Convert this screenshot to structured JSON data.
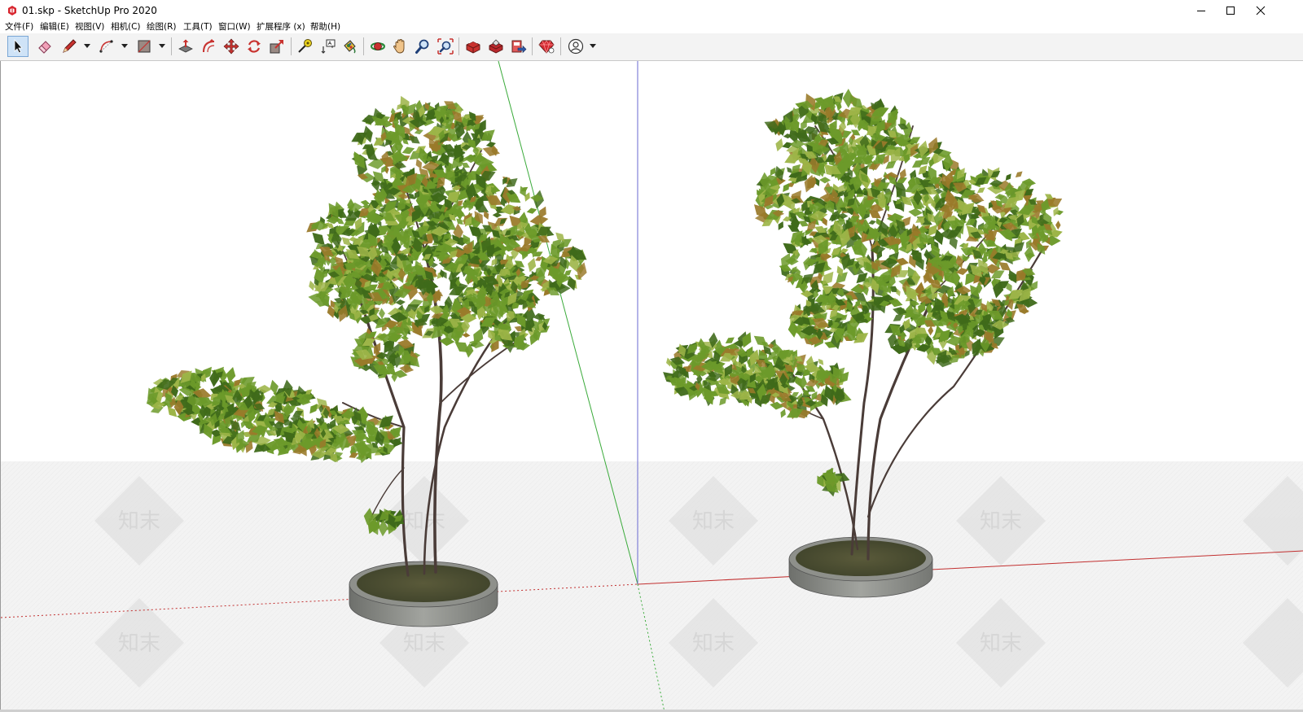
{
  "window": {
    "title": "01.skp - SketchUp Pro 2020"
  },
  "menu": [
    "文件(F)",
    "编辑(E)",
    "视图(V)",
    "相机(C)",
    "绘图(R)",
    "工具(T)",
    "窗口(W)",
    "扩展程序 (x)",
    "帮助(H)"
  ],
  "toolbar": {
    "tools": [
      {
        "icon": "select-arrow-icon",
        "active": true
      },
      {
        "icon": "eraser-icon"
      },
      {
        "icon": "pencil-line-icon"
      },
      {
        "icon": "arc-icon"
      },
      {
        "icon": "rectangle-shape-icon"
      },
      {
        "icon": "push-pull-icon"
      },
      {
        "icon": "offset-icon"
      },
      {
        "icon": "move-icon"
      },
      {
        "icon": "rotate-icon"
      },
      {
        "icon": "scale-icon"
      },
      {
        "icon": "tape-measure-icon"
      },
      {
        "icon": "text-icon"
      },
      {
        "icon": "paint-bucket-icon"
      },
      {
        "icon": "orbit-icon"
      },
      {
        "icon": "pan-hand-icon"
      },
      {
        "icon": "zoom-icon"
      },
      {
        "icon": "zoom-extents-icon"
      },
      {
        "icon": "3d-warehouse-icon"
      },
      {
        "icon": "extension-warehouse-icon"
      },
      {
        "icon": "send-to-layout-icon"
      },
      {
        "icon": "ruby-console-icon"
      },
      {
        "icon": "account-icon"
      }
    ]
  },
  "viewport": {
    "watermark": "知末",
    "colors": {
      "green_axis": "#3aaa3a",
      "red_axis": "#c23030",
      "blue_axis": "#6a6ad0",
      "leaf_dark": "#3f6a1a",
      "leaf_mid": "#6c9a2a",
      "leaf_light": "#9db548",
      "leaf_brown": "#9a7a2a",
      "trunk": "#4a3c38",
      "planter_rim": "#8c8e8a",
      "soil": "#4a4e32"
    }
  }
}
